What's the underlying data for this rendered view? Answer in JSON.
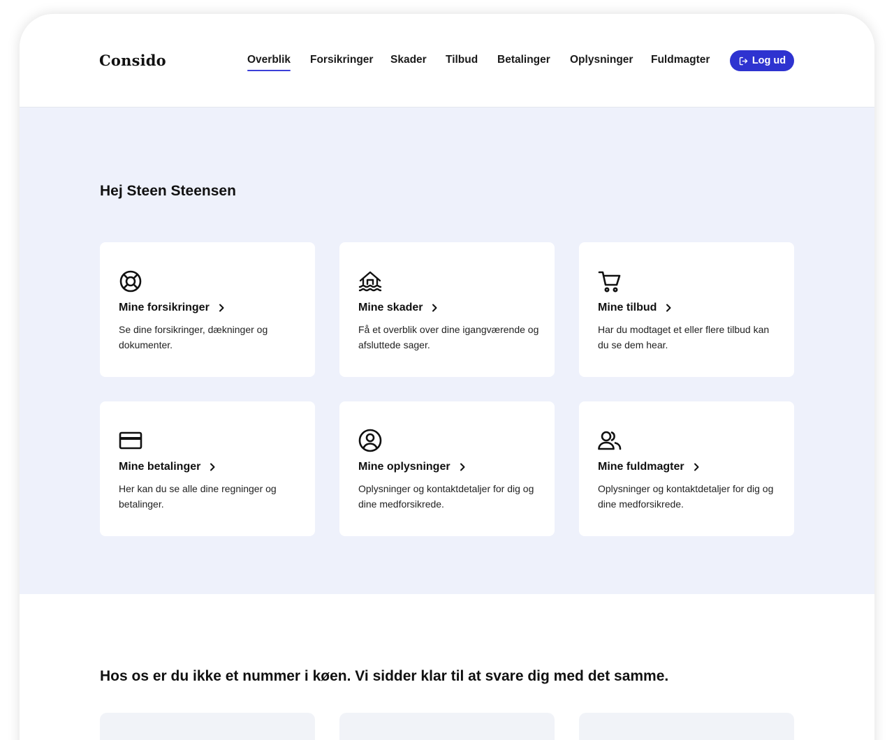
{
  "brand": {
    "logo_text": "Consido"
  },
  "nav": {
    "items": [
      {
        "label": "Overblik",
        "active": true
      },
      {
        "label": "Forsikringer",
        "active": false
      },
      {
        "label": "Skader",
        "active": false
      },
      {
        "label": "Tilbud",
        "active": false
      },
      {
        "label": "Betalinger",
        "active": false
      },
      {
        "label": "Oplysninger",
        "active": false
      },
      {
        "label": "Fuldmagter",
        "active": false
      }
    ],
    "logout_label": "Log ud",
    "logout_icon": "logout-icon"
  },
  "hero": {
    "greeting": "Hej Steen Steensen",
    "cards": [
      {
        "icon": "lifebuoy-icon",
        "title": "Mine forsikringer",
        "description": "Se dine forsikringer, dækninger og dokumenter."
      },
      {
        "icon": "flooded-house-icon",
        "title": "Mine skader",
        "description": "Få et overblik over dine igangværende og afsluttede sager."
      },
      {
        "icon": "shopping-cart-icon",
        "title": "Mine tilbud",
        "description": "Har du modtaget et eller flere tilbud kan du se dem hear."
      },
      {
        "icon": "credit-card-icon",
        "title": "Mine betalinger",
        "description": "Her kan du se alle dine regninger og betalinger."
      },
      {
        "icon": "user-circle-icon",
        "title": "Mine oplysninger",
        "description": "Oplysninger og kontaktdetaljer for dig og dine medforsikrede."
      },
      {
        "icon": "users-icon",
        "title": "Mine fuldmagter",
        "description": "Oplysninger og kontaktdetaljer for dig og dine medforsikrede."
      }
    ]
  },
  "support": {
    "heading": "Hos os er du ikke et nummer i køen. Vi sidder klar til at svare dig med det samme."
  },
  "colors": {
    "accent": "#2e33d0",
    "hero_background": "#eef1fb",
    "card_background": "#ffffff"
  }
}
